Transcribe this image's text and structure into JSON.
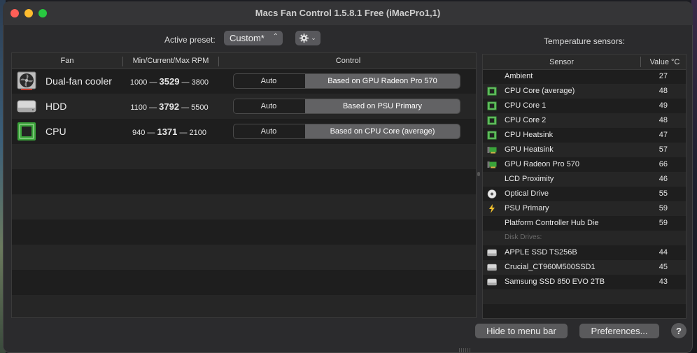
{
  "window": {
    "title": "Macs Fan Control 1.5.8.1 Free (iMacPro1,1)"
  },
  "preset": {
    "label": "Active preset:",
    "value": "Custom*"
  },
  "temperature_title": "Temperature sensors:",
  "fan_table": {
    "headers": {
      "fan": "Fan",
      "rpm": "Min/Current/Max RPM",
      "control": "Control"
    },
    "rows": [
      {
        "name": "Dual-fan cooler",
        "icon": "fan-cooler-icon",
        "min": "1000",
        "current": "3529",
        "max": "3800",
        "auto_label": "Auto",
        "based_label": "Based on GPU Radeon Pro 570"
      },
      {
        "name": "HDD",
        "icon": "hard-drive-icon",
        "min": "1100",
        "current": "3792",
        "max": "5500",
        "auto_label": "Auto",
        "based_label": "Based on PSU Primary"
      },
      {
        "name": "CPU",
        "icon": "cpu-chip-icon",
        "min": "940",
        "current": "1371",
        "max": "2100",
        "auto_label": "Auto",
        "based_label": "Based on CPU Core (average)"
      }
    ]
  },
  "sensor_table": {
    "headers": {
      "sensor": "Sensor",
      "value": "Value °C"
    },
    "rows": [
      {
        "name": "Ambient",
        "value": "27",
        "icon": "none"
      },
      {
        "name": "CPU Core (average)",
        "value": "48",
        "icon": "cpu-chip-icon"
      },
      {
        "name": "CPU Core 1",
        "value": "49",
        "icon": "cpu-chip-icon"
      },
      {
        "name": "CPU Core 2",
        "value": "48",
        "icon": "cpu-chip-icon"
      },
      {
        "name": "CPU Heatsink",
        "value": "47",
        "icon": "cpu-chip-icon"
      },
      {
        "name": "GPU Heatsink",
        "value": "57",
        "icon": "gpu-card-icon"
      },
      {
        "name": "GPU Radeon Pro 570",
        "value": "66",
        "icon": "gpu-card-icon"
      },
      {
        "name": "LCD Proximity",
        "value": "46",
        "icon": "none"
      },
      {
        "name": "Optical Drive",
        "value": "55",
        "icon": "optical-disc-icon"
      },
      {
        "name": "PSU Primary",
        "value": "59",
        "icon": "lightning-icon"
      },
      {
        "name": "Platform Controller Hub Die",
        "value": "59",
        "icon": "none"
      },
      {
        "group": "Disk Drives:"
      },
      {
        "name": "APPLE SSD TS256B",
        "value": "44",
        "icon": "hard-drive-icon"
      },
      {
        "name": "Crucial_CT960M500SSD1",
        "value": "45",
        "icon": "hard-drive-icon"
      },
      {
        "name": "Samsung SSD 850 EVO 2TB",
        "value": "43",
        "icon": "hard-drive-icon"
      }
    ]
  },
  "buttons": {
    "hide": "Hide to menu bar",
    "preferences": "Preferences...",
    "help": "?"
  },
  "colors": {
    "close": "#ff5f57",
    "minimize": "#febc2e",
    "maximize": "#28c840",
    "chip_green": "#3aa33a"
  }
}
